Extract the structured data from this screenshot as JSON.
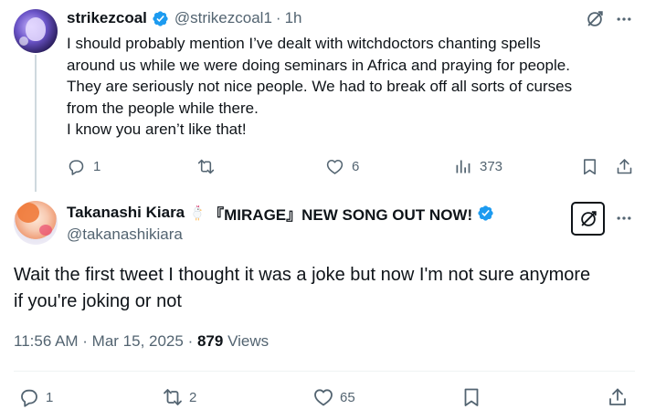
{
  "tweet1": {
    "display_name": "strikezcoal",
    "handle": "@strikezcoal1",
    "separator": "·",
    "time": "1h",
    "lines": [
      "I should probably mention I’ve dealt with witchdoctors chanting spells",
      "around us while we were doing seminars in Africa and praying for people.",
      "They are seriously not nice people. We had to break off all sorts of curses",
      "from the people while there.",
      "I know you aren’t like that!"
    ],
    "replies": "1",
    "retweets": "",
    "likes": "6",
    "views": "373"
  },
  "tweet2": {
    "display_name": "Takanashi Kiara",
    "name_suffix": "『MIRAGE』NEW SONG OUT NOW!",
    "handle": "@takanashikiara",
    "lines": [
      "Wait the first tweet I thought it was a joke but now I'm not sure anymore",
      "if you're joking or not"
    ],
    "timestamp": "11:56 AM · Mar 15, 2025 · ",
    "views_count": "879",
    "views_label": " Views",
    "replies": "1",
    "retweets": "2",
    "likes": "65"
  },
  "colors": {
    "text": "#0f1419",
    "secondary": "#536471",
    "verified": "#1d9bf0",
    "thread_line": "#cfd9de",
    "divider": "#eff3f4"
  },
  "icons": [
    "verified-badge-icon",
    "grok-icon",
    "more-icon",
    "reply-icon",
    "retweet-icon",
    "like-icon",
    "views-icon",
    "bookmark-icon",
    "share-icon",
    "chicken-emoji-icon"
  ]
}
